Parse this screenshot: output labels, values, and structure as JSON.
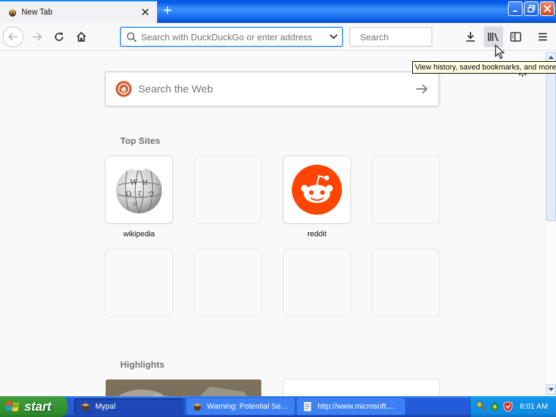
{
  "browser": {
    "tab": {
      "title": "New Tab"
    },
    "urlbar": {
      "placeholder": "Search with DuckDuckGo or enter address",
      "value": ""
    },
    "searchbar": {
      "placeholder": "Search",
      "value": ""
    },
    "tooltip": "View history, saved bookmarks, and more"
  },
  "newtab": {
    "search_placeholder": "Search the Web",
    "top_sites_title": "Top Sites",
    "highlights_title": "Highlights",
    "top_sites": [
      {
        "label": "wikipedia",
        "icon": "wikipedia-globe-icon"
      },
      {
        "label": "",
        "icon": ""
      },
      {
        "label": "reddit",
        "icon": "reddit-alien-icon"
      },
      {
        "label": "",
        "icon": ""
      },
      {
        "label": "",
        "icon": ""
      },
      {
        "label": "",
        "icon": ""
      },
      {
        "label": "",
        "icon": ""
      },
      {
        "label": "",
        "icon": ""
      }
    ]
  },
  "taskbar": {
    "start_label": "start",
    "tasks": [
      {
        "label": "Mypal",
        "active": true
      },
      {
        "label": "Warning: Potential Se...",
        "active": false
      },
      {
        "label": "http://www.microsoft....",
        "active": false
      }
    ],
    "clock": "6:01 AM"
  },
  "colors": {
    "accent": "#0a84ff",
    "xp_blue": "#245edc",
    "xp_start_green": "#3c9a3a",
    "reddit_orange": "#ff4500",
    "ddg_orange": "#de5833",
    "tooltip_bg": "#ffffe1"
  }
}
